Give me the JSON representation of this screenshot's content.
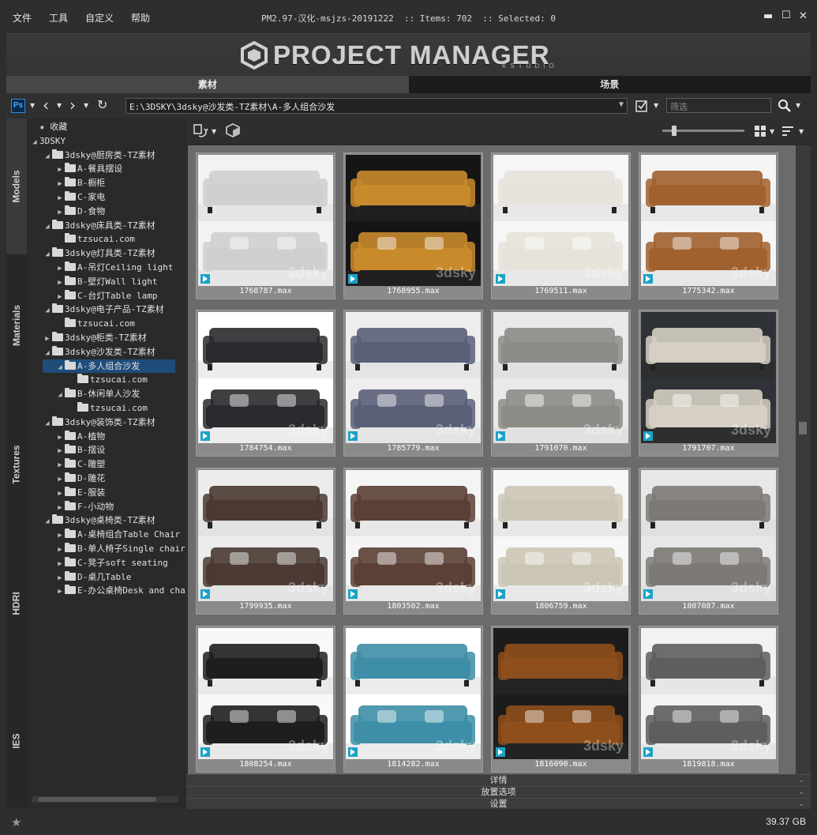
{
  "menu": [
    "文件",
    "工具",
    "自定义",
    "帮助"
  ],
  "title_info": "PM2.97-汉化-msjzs-20191222  :: Items: 702  :: Selected: 0",
  "window_controls": [
    "close-icon",
    "maximize-icon",
    "minimize-icon"
  ],
  "banner": {
    "logo_text": "PROJECT MANAGER",
    "logo_sub": "KSTUDIO"
  },
  "tabs": [
    "素材",
    "场景"
  ],
  "toolbar": {
    "path": "E:\\3DSKY\\3dsky@沙发类-TZ素材\\A-多人组合沙发",
    "filter_placeholder": "筛选"
  },
  "vtabs": [
    "Models",
    "Materials",
    "Textures",
    "HDRI",
    "IES"
  ],
  "tree": [
    {
      "label": "收藏",
      "level": 0,
      "expander": "",
      "icon": "star-folder"
    },
    {
      "label": "3DSKY",
      "level": 0,
      "expander": "open",
      "icon": ""
    },
    {
      "label": "3dsky@厨房类-TZ素材",
      "level": 1,
      "expander": "open",
      "icon": "folder"
    },
    {
      "label": "A-餐具摆设",
      "level": 2,
      "expander": "closed",
      "icon": "folder"
    },
    {
      "label": "B-橱柜",
      "level": 2,
      "expander": "closed",
      "icon": "folder"
    },
    {
      "label": "C-家电",
      "level": 2,
      "expander": "closed",
      "icon": "folder"
    },
    {
      "label": "D-食物",
      "level": 2,
      "expander": "closed",
      "icon": "folder"
    },
    {
      "label": "3dsky@床具类-TZ素材",
      "level": 1,
      "expander": "open",
      "icon": "folder"
    },
    {
      "label": "tzsucai.com",
      "level": 2,
      "expander": "",
      "icon": "folder"
    },
    {
      "label": "3dsky@灯具类-TZ素材",
      "level": 1,
      "expander": "open",
      "icon": "folder"
    },
    {
      "label": "A-吊灯Ceiling light",
      "level": 2,
      "expander": "closed",
      "icon": "folder"
    },
    {
      "label": "B-壁灯Wall light",
      "level": 2,
      "expander": "closed",
      "icon": "folder"
    },
    {
      "label": "C-台灯Table lamp",
      "level": 2,
      "expander": "closed",
      "icon": "folder"
    },
    {
      "label": "3dsky@电子产品-TZ素材",
      "level": 1,
      "expander": "open",
      "icon": "folder"
    },
    {
      "label": "tzsucai.com",
      "level": 2,
      "expander": "",
      "icon": "folder"
    },
    {
      "label": "3dsky@柜类-TZ素材",
      "level": 1,
      "expander": "closed",
      "icon": "folder"
    },
    {
      "label": "3dsky@沙发类-TZ素材",
      "level": 1,
      "expander": "open",
      "icon": "folder"
    },
    {
      "label": "A-多人组合沙发",
      "level": 2,
      "expander": "open",
      "icon": "folder",
      "selected": true
    },
    {
      "label": "tzsucai.com",
      "level": 3,
      "expander": "",
      "icon": "folder"
    },
    {
      "label": "B-休闲单人沙发",
      "level": 2,
      "expander": "open",
      "icon": "folder"
    },
    {
      "label": "tzsucai.com",
      "level": 3,
      "expander": "",
      "icon": "folder"
    },
    {
      "label": "3dsky@装饰类-TZ素材",
      "level": 1,
      "expander": "open",
      "icon": "folder"
    },
    {
      "label": "A-植物",
      "level": 2,
      "expander": "closed",
      "icon": "folder"
    },
    {
      "label": "B-摆设",
      "level": 2,
      "expander": "closed",
      "icon": "folder"
    },
    {
      "label": "C-雕塑",
      "level": 2,
      "expander": "closed",
      "icon": "folder"
    },
    {
      "label": "D-雕花",
      "level": 2,
      "expander": "closed",
      "icon": "folder"
    },
    {
      "label": "E-服装",
      "level": 2,
      "expander": "closed",
      "icon": "folder"
    },
    {
      "label": "F-小动物",
      "level": 2,
      "expander": "closed",
      "icon": "folder"
    },
    {
      "label": "3dsky@桌椅类-TZ素材",
      "level": 1,
      "expander": "open",
      "icon": "folder"
    },
    {
      "label": "A-桌椅组合Table Chair",
      "level": 2,
      "expander": "closed",
      "icon": "folder"
    },
    {
      "label": "B-单人椅子Single chair",
      "level": 2,
      "expander": "closed",
      "icon": "folder"
    },
    {
      "label": "C-凳子soft seating",
      "level": 2,
      "expander": "closed",
      "icon": "folder"
    },
    {
      "label": "D-桌几Table",
      "level": 2,
      "expander": "closed",
      "icon": "folder"
    },
    {
      "label": "E-办公桌椅Desk and chair",
      "level": 2,
      "expander": "closed",
      "icon": "folder"
    }
  ],
  "items": [
    {
      "file": "1768787.max",
      "bg": "#f2f2f2",
      "sofa": "#cfcfcf",
      "dark": false
    },
    {
      "file": "1768955.max",
      "bg": "#151515",
      "sofa": "#c98a2c",
      "dark": true
    },
    {
      "file": "1769511.max",
      "bg": "#f6f6f6",
      "sofa": "#e6e3da",
      "dark": false
    },
    {
      "file": "1775342.max",
      "bg": "#f5f5f5",
      "sofa": "#a0612f",
      "dark": false
    },
    {
      "file": "1784754.max",
      "bg": "#ffffff",
      "sofa": "#2a2a2e",
      "dark": false
    },
    {
      "file": "1785779.max",
      "bg": "#eeeeee",
      "sofa": "#5a5f78",
      "dark": false
    },
    {
      "file": "1791070.max",
      "bg": "#e9e9e9",
      "sofa": "#8e8c87",
      "dark": false
    },
    {
      "file": "1791707.max",
      "bg": "#2f3236",
      "sofa": "#d6cfc3",
      "dark": true
    },
    {
      "file": "1799935.max",
      "bg": "#ececec",
      "sofa": "#4a3a33",
      "dark": false
    },
    {
      "file": "1803502.max",
      "bg": "#f4f4f4",
      "sofa": "#5b4036",
      "dark": false
    },
    {
      "file": "1806759.max",
      "bg": "#f7f7f7",
      "sofa": "#cbc5b4",
      "dark": false
    },
    {
      "file": "1807087.max",
      "bg": "#e7e7e7",
      "sofa": "#7d7a76",
      "dark": false
    },
    {
      "file": "1808254.max",
      "bg": "#f8f8f8",
      "sofa": "#1e1e1f",
      "dark": false
    },
    {
      "file": "1814282.max",
      "bg": "#ffffff",
      "sofa": "#3d8ea6",
      "dark": false
    },
    {
      "file": "1816090.max",
      "bg": "#1c1c1c",
      "sofa": "#8e4f1c",
      "dark": true
    },
    {
      "file": "1819818.max",
      "bg": "#f2f2f2",
      "sofa": "#5e5e60",
      "dark": false
    }
  ],
  "watermark": "3dsky",
  "panels": [
    "详情",
    "放置选项",
    "设置"
  ],
  "status": {
    "disk_free": "39.37 GB"
  }
}
